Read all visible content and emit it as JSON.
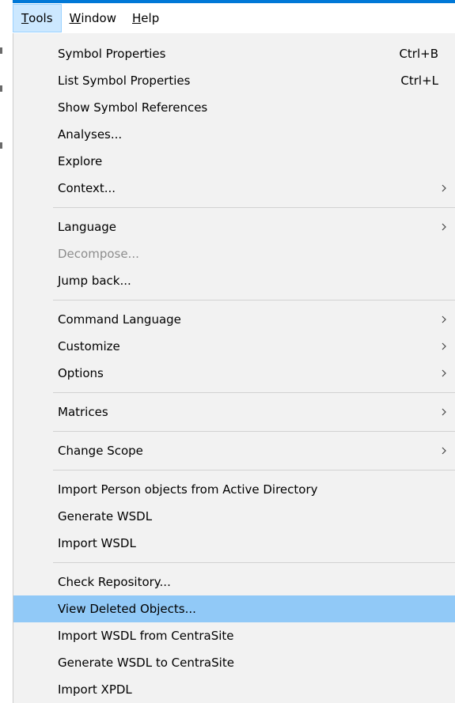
{
  "menubar": [
    {
      "id": "tools",
      "mnemonic": "T",
      "rest": "ools",
      "active": true
    },
    {
      "id": "window",
      "mnemonic": "W",
      "rest": "indow",
      "active": false
    },
    {
      "id": "help",
      "mnemonic": "H",
      "rest": "elp",
      "active": false
    }
  ],
  "groups": [
    [
      {
        "label": "Symbol Properties",
        "shortcut": "Ctrl+B"
      },
      {
        "label": "List Symbol Properties",
        "shortcut": "Ctrl+L"
      },
      {
        "label": "Show Symbol References"
      },
      {
        "label": "Analyses..."
      },
      {
        "label": "Explore"
      },
      {
        "label": "Context...",
        "submenu": true
      }
    ],
    [
      {
        "label": "Language",
        "submenu": true
      },
      {
        "label": "Decompose...",
        "disabled": true
      },
      {
        "label": "Jump back..."
      }
    ],
    [
      {
        "label": "Command Language",
        "submenu": true
      },
      {
        "label": "Customize",
        "submenu": true
      },
      {
        "label": "Options",
        "submenu": true
      }
    ],
    [
      {
        "label": "Matrices",
        "submenu": true
      }
    ],
    [
      {
        "label": "Change Scope",
        "submenu": true
      }
    ],
    [
      {
        "label": "Import Person objects from Active Directory"
      },
      {
        "label": "Generate WSDL"
      },
      {
        "label": "Import WSDL"
      }
    ],
    [
      {
        "label": "Check Repository..."
      },
      {
        "label": "View Deleted Objects...",
        "highlighted": true
      },
      {
        "label": "Import WSDL from CentraSite"
      },
      {
        "label": "Generate WSDL to CentraSite"
      },
      {
        "label": "Import XPDL"
      }
    ]
  ]
}
